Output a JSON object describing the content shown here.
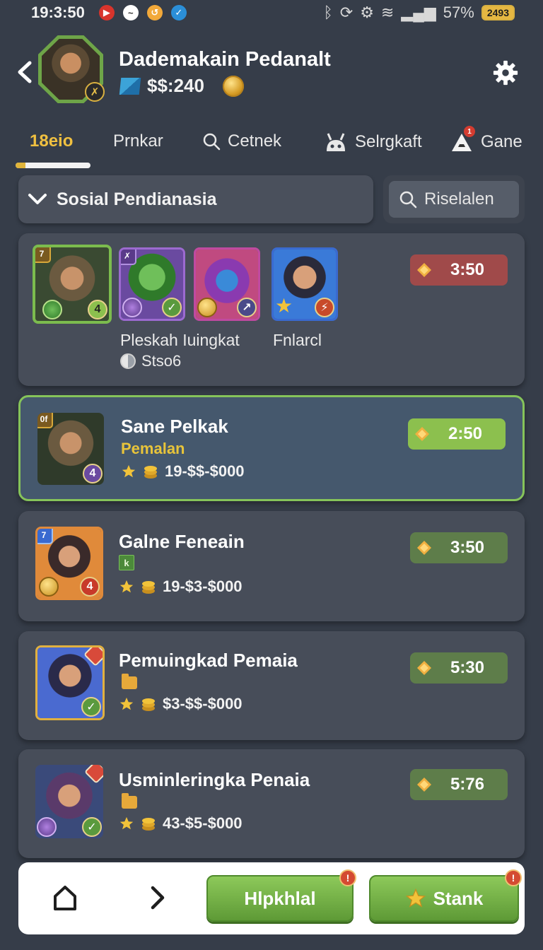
{
  "status_bar": {
    "time": "19:3:50",
    "battery_percent": "57%",
    "battery_label": "2493"
  },
  "header": {
    "player_name": "Dademakain Pedanalt",
    "currency_value": "$$:240"
  },
  "tabs": [
    {
      "label": "18eio",
      "icon": "none",
      "active": true
    },
    {
      "label": "Prnkar",
      "icon": "none",
      "active": false
    },
    {
      "label": "Cetnek",
      "icon": "search-icon",
      "active": false
    },
    {
      "label": "Selrgkaft",
      "icon": "robot-icon",
      "active": false
    },
    {
      "label": "Gane",
      "icon": "cone-icon",
      "active": false,
      "badge": "1"
    }
  ],
  "filter": {
    "dropdown_label": "Sosial Pendianasia",
    "search_label": "Riselalen"
  },
  "group_card": {
    "portraits": [
      {
        "name": "portrait-hooded",
        "badge_br": "4"
      },
      {
        "name": "portrait-green-warrior"
      },
      {
        "name": "portrait-masked"
      },
      {
        "name": "portrait-young-hero"
      }
    ],
    "group_name_1": "Pleskah Iuingkat",
    "group_name_2": "Fnlarcl",
    "status_text": "Stso6",
    "time": "3:50"
  },
  "cards": [
    {
      "title": "Sane Pelkak",
      "subtitle": "Pemalan",
      "stats": "19-$$-$000",
      "time": "2:50",
      "badge_tl": "0f",
      "badge_br": "4"
    },
    {
      "title": "Galne Feneain",
      "tag": "k",
      "stats": "19-$3-$000",
      "time": "3:50",
      "badge_br": "4"
    },
    {
      "title": "Pemuingkad Pemaia",
      "stats": "$3-$$-$000",
      "time": "5:30"
    },
    {
      "title": "Usminleringka Penaia",
      "stats": "43-$5-$000",
      "time": "5:76"
    }
  ],
  "bottom_bar": {
    "button_1": "Hlpkhlal",
    "button_2": "Stank",
    "alert": "!"
  },
  "colors": {
    "background": "#363d49",
    "card": "#474d59",
    "highlight_border": "#86c45a",
    "accent_gold": "#e8c43a",
    "button_green": "#6faa44"
  }
}
